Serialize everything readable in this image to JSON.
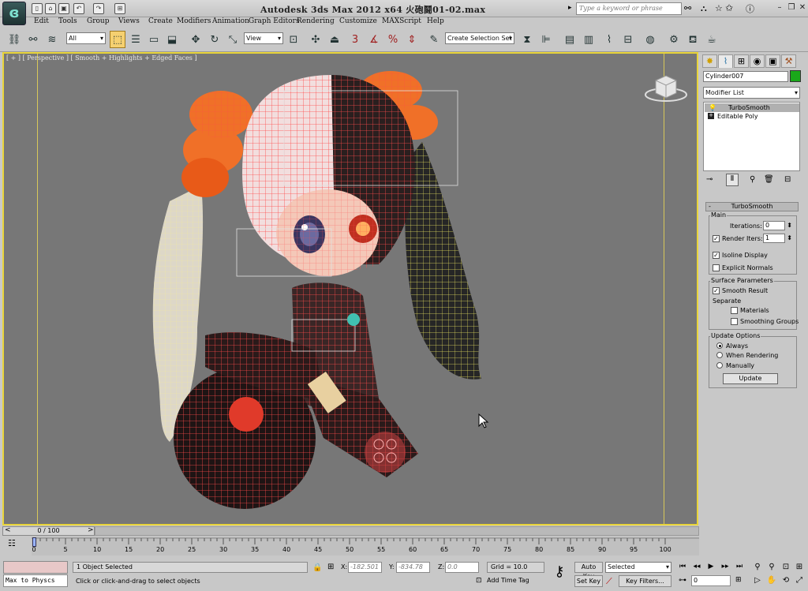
{
  "titlebar": {
    "title": "Autodesk 3ds Max  2012 x64     火砲鬪01-02.max",
    "search_placeholder": "Type a keyword or phrase",
    "icons": [
      "app-logo",
      "new-file-icon",
      "open-file-icon",
      "save-icon",
      "undo-icon",
      "redo-icon",
      "project-icon",
      "binoculars-icon",
      "star-icon",
      "help-icon",
      "minimize-icon",
      "restore-icon",
      "close-icon"
    ]
  },
  "menu": [
    "Edit",
    "Tools",
    "Group",
    "Views",
    "Create",
    "Modifiers",
    "Animation",
    "Graph Editors",
    "Rendering",
    "Customize",
    "MAXScript",
    "Help"
  ],
  "toolbar": {
    "selection_filter": "All",
    "reference_coord": "View",
    "named_selection_set": "Create Selection Set",
    "snap_number": "3"
  },
  "viewport": {
    "label": "[ + ] [ Perspective ] [ Smooth + Highlights + Edged Faces ]",
    "background": "#777777",
    "border": "#e8d43a"
  },
  "command_panel": {
    "object_name": "Cylinder007",
    "object_color": "#1aa81a",
    "modifier_list": "Modifier List",
    "stack": [
      "TurboSmooth",
      "Editable Poly"
    ],
    "rollout_title": "TurboSmooth",
    "main_group": "Main",
    "iterations_label": "Iterations:",
    "iterations_value": "0",
    "render_iters_label": "Render Iters:",
    "render_iters_value": "1",
    "render_iters_checked": true,
    "isoline_label": "Isoline Display",
    "isoline_checked": true,
    "explicit_normals_label": "Explicit Normals",
    "explicit_normals_checked": false,
    "surface_group": "Surface Parameters",
    "smooth_result_label": "Smooth Result",
    "smooth_result_checked": true,
    "separate_label": "Separate",
    "materials_label": "Materials",
    "smoothing_groups_label": "Smoothing Groups",
    "update_group": "Update Options",
    "always_label": "Always",
    "when_rendering_label": "When Rendering",
    "manually_label": "Manually",
    "update_option_selected": "Always",
    "update_button": "Update"
  },
  "timeline": {
    "frame_display": "0 / 100",
    "ticks": [
      "0",
      "5",
      "10",
      "15",
      "20",
      "25",
      "30",
      "35",
      "40",
      "45",
      "50",
      "55",
      "60",
      "65",
      "70",
      "75",
      "80",
      "85",
      "90",
      "95",
      "100"
    ],
    "next_arrow": ">",
    "prev_arrow": "<"
  },
  "status": {
    "maxscript_mini": "Max to Physcs",
    "selection_status": "1 Object Selected",
    "prompt": "Click or click-and-drag to select objects",
    "x_label": "X:",
    "x_value": "-182.501",
    "y_label": "Y:",
    "y_value": "-834.78",
    "z_label": "Z:",
    "z_value": "0.0",
    "grid": "Grid = 10.0",
    "add_time_tag": "Add Time Tag",
    "auto_key": "Auto Key",
    "set_key": "Set Key",
    "selected_dropdown": "Selected",
    "key_filters": "Key Filters...",
    "current_frame": "0"
  }
}
